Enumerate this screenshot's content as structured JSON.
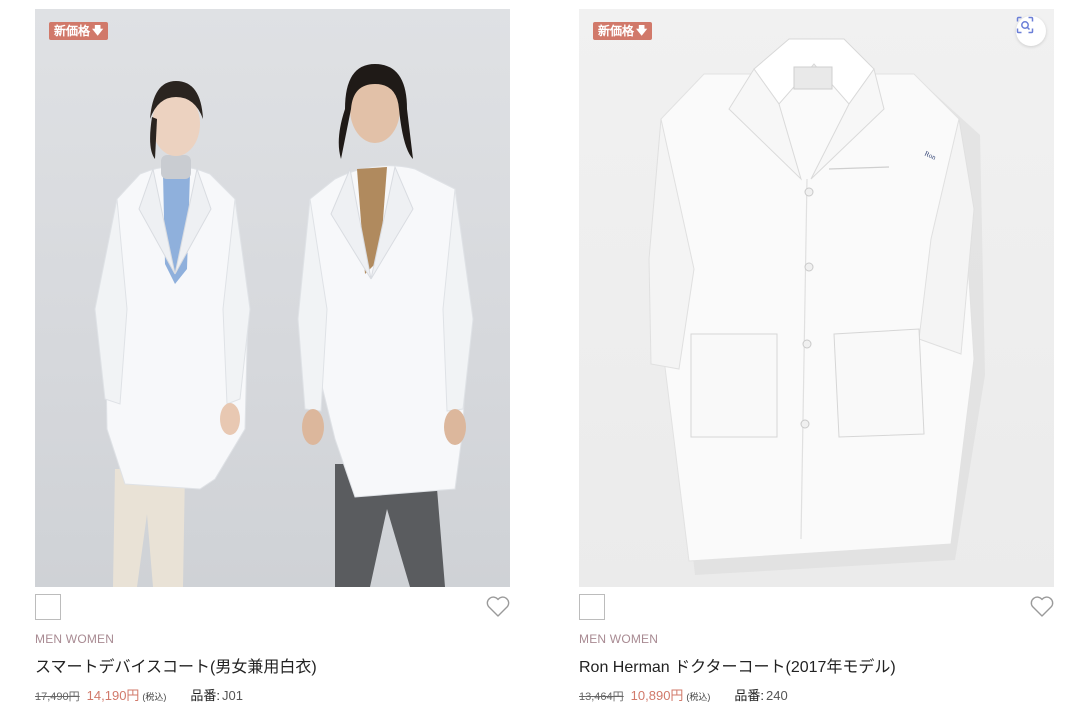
{
  "products": [
    {
      "badge": "新価格",
      "badge_arrow": "🡇",
      "category": "MEN WOMEN",
      "title": "スマートデバイスコート(男女兼用白衣)",
      "old_price": "17,490円",
      "new_price": "14,190円",
      "tax": "(税込)",
      "code_label": "品番:",
      "code": "J01",
      "swatch_color": "#ffffff"
    },
    {
      "badge": "新価格",
      "badge_arrow": "🡇",
      "category": "MEN WOMEN",
      "title": "Ron Herman ドクターコート(2017年モデル)",
      "old_price": "13,464円",
      "new_price": "10,890円",
      "tax": "(税込)",
      "code_label": "品番:",
      "code": "240",
      "swatch_color": "#ffffff"
    }
  ],
  "colors": {
    "accent": "#d1796a",
    "category": "#a88a92"
  },
  "icons": {
    "heart": "heart-outline-icon",
    "scan": "visual-search-icon",
    "badge_arrow": "arrow-down-icon"
  }
}
